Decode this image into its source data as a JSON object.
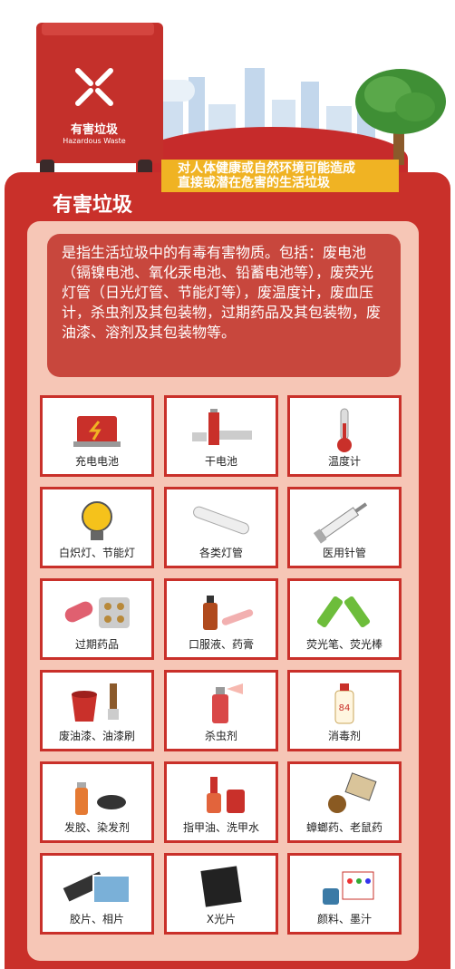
{
  "bin": {
    "label_cn": "有害垃圾",
    "label_en": "Hazardous Waste",
    "icon": "hazard-x-icon"
  },
  "banner": {
    "line1": "对人体健康或自然环境可能造成",
    "line2": "直接或潜在危害的生活垃圾"
  },
  "section": {
    "title": "有害垃圾",
    "description": "是指生活垃圾中的有毒有害物质。包括：废电池（镉镍电池、氧化汞电池、铅蓄电池等），废荧光灯管（日光灯管、节能灯等），废温度计，废血压计，杀虫剂及其包装物，过期药品及其包装物，废油漆、溶剂及其包装物等。"
  },
  "items": [
    {
      "label": "充电电池",
      "icon": "rechargeable-battery-icon"
    },
    {
      "label": "干电池",
      "icon": "dry-battery-icon"
    },
    {
      "label": "温度计",
      "icon": "thermometer-icon"
    },
    {
      "label": "白炽灯、节能灯",
      "icon": "light-bulb-icon"
    },
    {
      "label": "各类灯管",
      "icon": "fluorescent-tube-icon"
    },
    {
      "label": "医用针管",
      "icon": "syringe-icon"
    },
    {
      "label": "过期药品",
      "icon": "pills-icon"
    },
    {
      "label": "口服液、药膏",
      "icon": "medicine-bottle-icon"
    },
    {
      "label": "荧光笔、荧光棒",
      "icon": "highlighter-icon"
    },
    {
      "label": "废油漆、油漆刷",
      "icon": "paint-bucket-icon"
    },
    {
      "label": "杀虫剂",
      "icon": "insecticide-spray-icon"
    },
    {
      "label": "消毒剂",
      "icon": "disinfectant-bottle-icon"
    },
    {
      "label": "发胶、染发剂",
      "icon": "hairspray-icon"
    },
    {
      "label": "指甲油、洗甲水",
      "icon": "nail-polish-icon"
    },
    {
      "label": "蟑螂药、老鼠药",
      "icon": "pesticide-pack-icon"
    },
    {
      "label": "胶片、相片",
      "icon": "film-photo-icon"
    },
    {
      "label": "X光片",
      "icon": "xray-film-icon"
    },
    {
      "label": "颜料、墨汁",
      "icon": "paint-ink-icon"
    }
  ],
  "colors": {
    "brand_red": "#c9302a",
    "panel_pink": "#f6c6b6",
    "banner_yellow": "#f0b323"
  }
}
